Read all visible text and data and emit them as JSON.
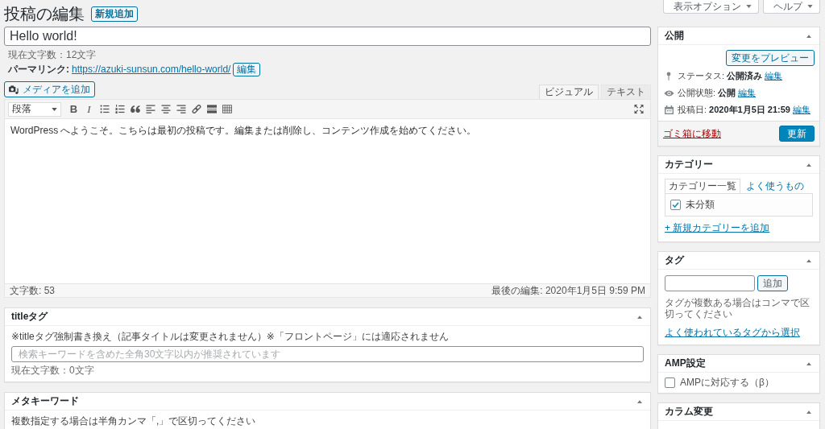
{
  "screen_tabs": [
    {
      "label": "表示オプション"
    },
    {
      "label": "ヘルプ"
    }
  ],
  "page": {
    "title": "投稿の編集",
    "add_new": "新規追加"
  },
  "post_title": {
    "value": "Hello world!",
    "count": "現在文字数：12文字"
  },
  "permalink": {
    "label": "パーマリンク:",
    "url": "https://azuki-sunsun.com/hello-world/",
    "edit": "編集"
  },
  "media_button": "メディアを追加",
  "editor": {
    "tabs": [
      {
        "label": "ビジュアル",
        "selected": true
      },
      {
        "label": "テキスト",
        "selected": false
      }
    ],
    "toolbar": {
      "format": "段落",
      "bold": "B",
      "italic": "I"
    },
    "content": "WordPress へようこそ。こちらは最初の投稿です。編集または削除し、コンテンツ作成を始めてください。",
    "status_bar": {
      "word_count": "文字数: 53",
      "last_edit": "最後の編集: 2020年1月5日 9:59 PM"
    }
  },
  "main_boxes": [
    {
      "kind": "field",
      "title": "titleタグ",
      "note": "※titleタグ強制書き換え（記事タイトルは変更されません）※「フロントページ」には適応されません",
      "placeholder": "検索キーワードを含めた全角30文字以内が推奨されています",
      "count": "現在文字数：0文字"
    },
    {
      "kind": "note",
      "title": "メタキーワード",
      "note": "複数指定する場合は半角カンマ「,」で区切ってください"
    }
  ],
  "sidebar": [
    {
      "kind": "publish",
      "title": "公開",
      "preview": "変更をプレビュー",
      "rows": [
        {
          "kind": "status",
          "label": "ステータス:",
          "value": "公開済み",
          "edit": "編集"
        },
        {
          "kind": "visibility",
          "label": "公開状態:",
          "value": "公開",
          "edit": "編集"
        },
        {
          "kind": "date",
          "label": "投稿日:",
          "value": "2020年1月5日 21:59",
          "edit": "編集"
        }
      ],
      "trash": "ゴミ箱に移動",
      "update": "更新"
    },
    {
      "kind": "categories",
      "title": "カテゴリー",
      "tabs": [
        {
          "label": "カテゴリー一覧",
          "selected": true
        },
        {
          "label": "よく使うもの",
          "selected": false
        }
      ],
      "items": [
        {
          "label": "未分類",
          "checked": true
        }
      ],
      "add_link": "+ 新規カテゴリーを追加"
    },
    {
      "kind": "tags",
      "title": "タグ",
      "add": "追加",
      "hint": "タグが複数ある場合はコンマで区切ってください",
      "choose_link": "よく使われているタグから選択"
    },
    {
      "kind": "amp",
      "title": "AMP設定",
      "option": {
        "label": "AMPに対応する（β）",
        "checked": false
      }
    },
    {
      "kind": "columns",
      "title": "カラム変更"
    }
  ]
}
